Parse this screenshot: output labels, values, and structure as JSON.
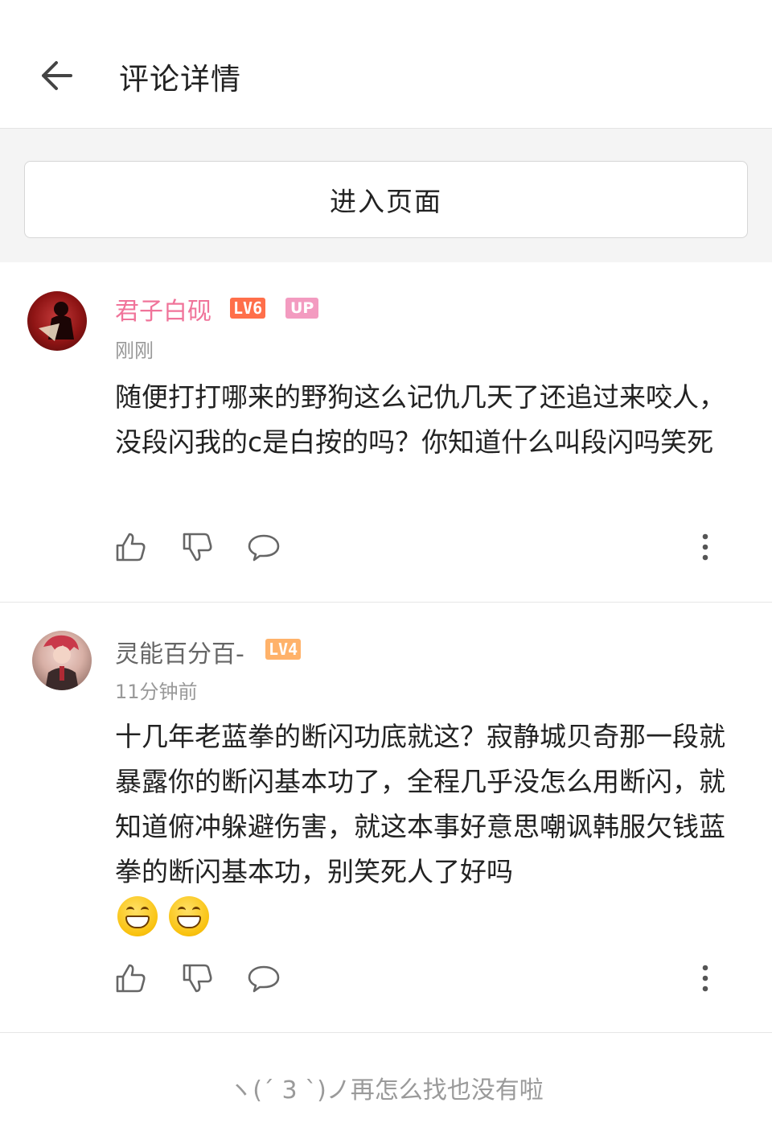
{
  "header": {
    "title": "评论详情",
    "back_icon": "arrow-left-icon"
  },
  "banner": {
    "enter_label": "进入页面"
  },
  "comments": [
    {
      "username": "君子白砚",
      "username_color": "#f0749a",
      "level": "LV6",
      "level_color": "#ff6f4a",
      "up_badge": "UP",
      "time": "刚刚",
      "text": "随便打打哪来的野狗这么记仇几天了还追过来咬人，没段闪我的c是白按的吗？你知道什么叫段闪吗笑死",
      "emojis": []
    },
    {
      "username": "灵能百分百-",
      "username_color": "#666666",
      "level": "LV4",
      "level_color": "#ffb26a",
      "up_badge": "",
      "time": "11分钟前",
      "text": "十几年老蓝拳的断闪功底就这？寂静城贝奇那一段就暴露你的断闪基本功了，全程几乎没怎么用断闪，就知道俯冲躲避伤害，就这本事好意思嘲讽韩服欠钱蓝拳的断闪基本功，别笑死人了好吗",
      "emojis": [
        "grin-emoji",
        "grin-emoji"
      ]
    }
  ],
  "footer": {
    "end_text": "ヽ(ˊ 3 ˋ)ノ再怎么找也没有啦"
  }
}
